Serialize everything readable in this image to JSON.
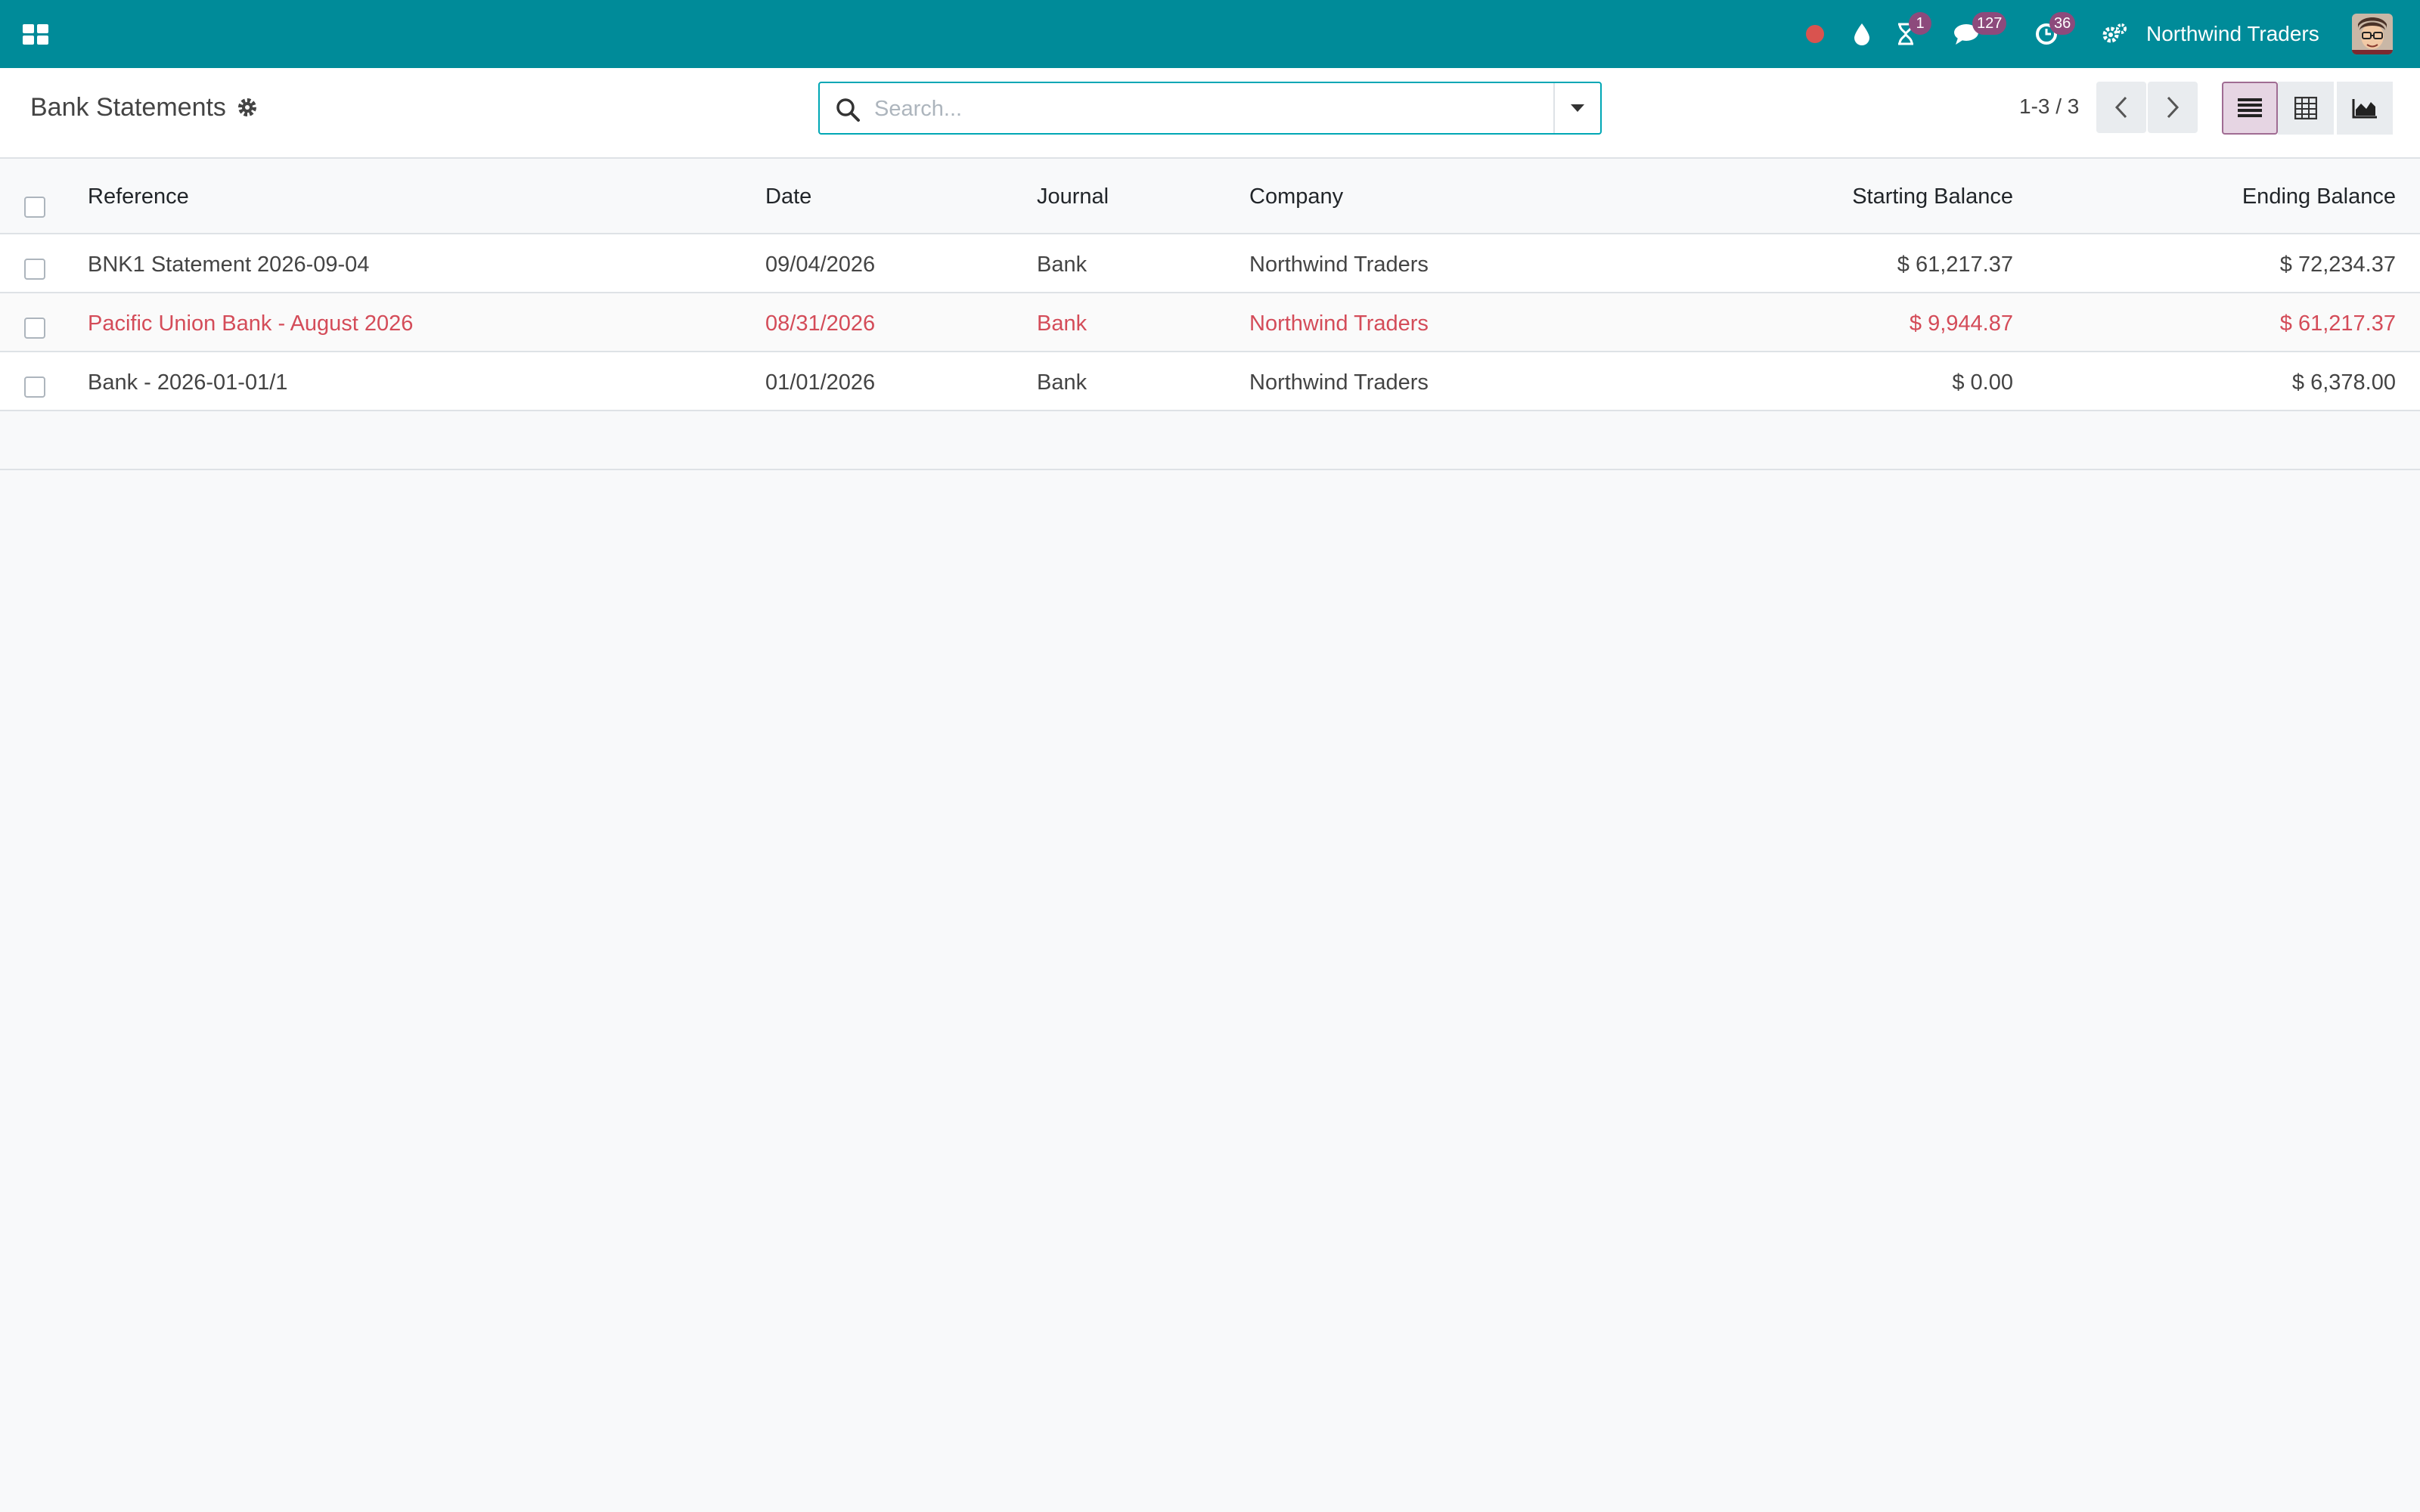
{
  "navbar": {
    "apps_icon": "apps-grid-icon",
    "systray": [
      {
        "name": "recording-indicator",
        "icon": "red-dot",
        "badge": ""
      },
      {
        "name": "drop",
        "icon": "water-drop-icon",
        "badge": ""
      },
      {
        "name": "activities",
        "icon": "hourglass-icon",
        "badge": "1"
      },
      {
        "name": "messages",
        "icon": "chat-icon",
        "badge": "127"
      },
      {
        "name": "timer",
        "icon": "clock-icon",
        "badge": "36"
      },
      {
        "name": "settings",
        "icon": "gears-icon",
        "badge": ""
      }
    ],
    "company": "Northwind Traders",
    "colors": {
      "navbar_bg": "#008b99",
      "badge_bg": "#8d4a7c"
    }
  },
  "control_panel": {
    "title": "Bank Statements",
    "search": {
      "placeholder": "Search...",
      "value": ""
    },
    "pager": "1-3 / 3",
    "views": [
      {
        "name": "list",
        "icon": "list-view-icon",
        "active": true
      },
      {
        "name": "pivot",
        "icon": "pivot-table-icon",
        "active": false
      },
      {
        "name": "graph",
        "icon": "area-chart-icon",
        "active": false
      }
    ]
  },
  "table": {
    "columns": {
      "reference": "Reference",
      "date": "Date",
      "journal": "Journal",
      "company": "Company",
      "starting_balance": "Starting Balance",
      "ending_balance": "Ending Balance"
    },
    "rows": [
      {
        "reference": "BNK1 Statement 2026-09-04",
        "date": "09/04/2026",
        "journal": "Bank",
        "company": "Northwind Traders",
        "starting_balance": "$ 61,217.37",
        "ending_balance": "$ 72,234.37",
        "status": "normal"
      },
      {
        "reference": "Pacific Union Bank - August 2026",
        "date": "08/31/2026",
        "journal": "Bank",
        "company": "Northwind Traders",
        "starting_balance": "$ 9,944.87",
        "ending_balance": "$ 61,217.37",
        "status": "danger"
      },
      {
        "reference": "Bank - 2026-01-01/1",
        "date": "01/01/2026",
        "journal": "Bank",
        "company": "Northwind Traders",
        "starting_balance": "$ 0.00",
        "ending_balance": "$ 6,378.00",
        "status": "normal"
      }
    ],
    "colors": {
      "danger_text": "#d44c59"
    }
  }
}
